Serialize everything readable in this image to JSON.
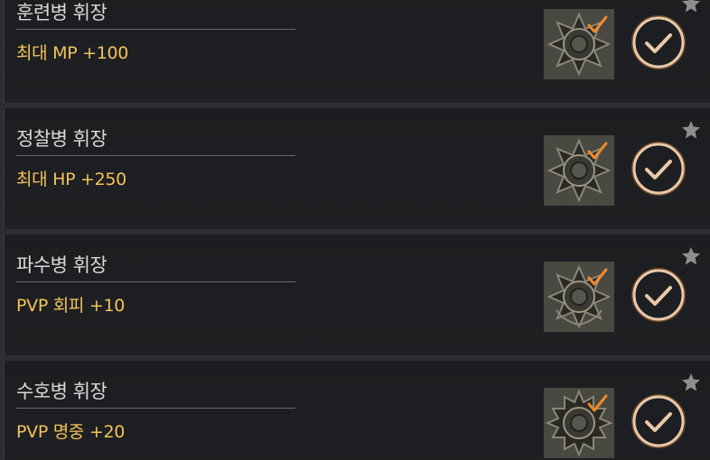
{
  "medals": [
    {
      "title": "훈련병 휘장",
      "stat": "최대 MP +100",
      "checked": true,
      "star_icon": "star-icon"
    },
    {
      "title": "정찰병 휘장",
      "stat": "최대 HP +250",
      "checked": true,
      "star_icon": "star-icon"
    },
    {
      "title": "파수병 휘장",
      "stat": "PVP 회피 +10",
      "checked": true,
      "star_icon": "star-icon"
    },
    {
      "title": "수호병 휘장",
      "stat": "PVP 명중 +20",
      "checked": true,
      "star_icon": "star-icon"
    }
  ],
  "colors": {
    "stat_text": "#f2c35b",
    "title_text": "#d9d9d9",
    "check_ring": "#d9a56a",
    "badge_check": "#f08a2a"
  }
}
